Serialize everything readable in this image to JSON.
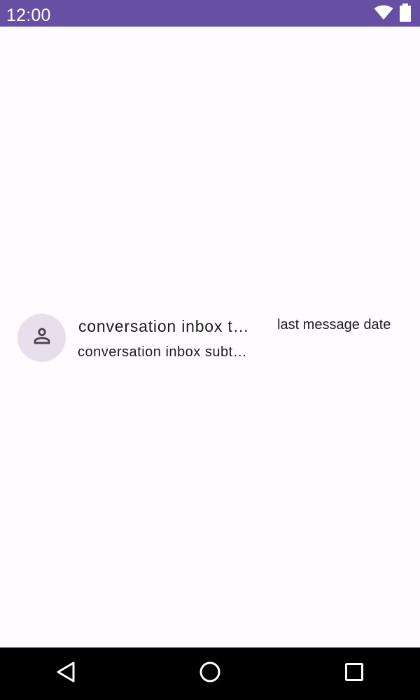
{
  "status_bar": {
    "time": "12:00",
    "icons": [
      "wifi-icon",
      "battery-icon"
    ],
    "background_color": "#6750a4"
  },
  "conversation": {
    "avatar_icon": "person-icon",
    "title": "conversation inbox t…",
    "subtitle": "conversation inbox subt…",
    "date": "last message date"
  },
  "nav_bar": {
    "buttons": [
      "back-icon",
      "home-icon",
      "recents-icon"
    ]
  },
  "colors": {
    "background": "#fffbfe",
    "avatar_bg": "#e7e0ec",
    "text": "#1c1b1f"
  }
}
